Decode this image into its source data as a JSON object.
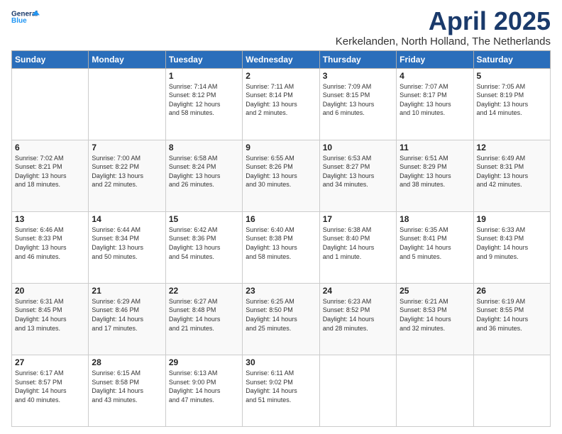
{
  "logo": {
    "line1": "General",
    "line2": "Blue"
  },
  "title": "April 2025",
  "location": "Kerkelanden, North Holland, The Netherlands",
  "weekdays": [
    "Sunday",
    "Monday",
    "Tuesday",
    "Wednesday",
    "Thursday",
    "Friday",
    "Saturday"
  ],
  "weeks": [
    [
      {
        "day": "",
        "info": ""
      },
      {
        "day": "",
        "info": ""
      },
      {
        "day": "1",
        "info": "Sunrise: 7:14 AM\nSunset: 8:12 PM\nDaylight: 12 hours\nand 58 minutes."
      },
      {
        "day": "2",
        "info": "Sunrise: 7:11 AM\nSunset: 8:14 PM\nDaylight: 13 hours\nand 2 minutes."
      },
      {
        "day": "3",
        "info": "Sunrise: 7:09 AM\nSunset: 8:15 PM\nDaylight: 13 hours\nand 6 minutes."
      },
      {
        "day": "4",
        "info": "Sunrise: 7:07 AM\nSunset: 8:17 PM\nDaylight: 13 hours\nand 10 minutes."
      },
      {
        "day": "5",
        "info": "Sunrise: 7:05 AM\nSunset: 8:19 PM\nDaylight: 13 hours\nand 14 minutes."
      }
    ],
    [
      {
        "day": "6",
        "info": "Sunrise: 7:02 AM\nSunset: 8:21 PM\nDaylight: 13 hours\nand 18 minutes."
      },
      {
        "day": "7",
        "info": "Sunrise: 7:00 AM\nSunset: 8:22 PM\nDaylight: 13 hours\nand 22 minutes."
      },
      {
        "day": "8",
        "info": "Sunrise: 6:58 AM\nSunset: 8:24 PM\nDaylight: 13 hours\nand 26 minutes."
      },
      {
        "day": "9",
        "info": "Sunrise: 6:55 AM\nSunset: 8:26 PM\nDaylight: 13 hours\nand 30 minutes."
      },
      {
        "day": "10",
        "info": "Sunrise: 6:53 AM\nSunset: 8:27 PM\nDaylight: 13 hours\nand 34 minutes."
      },
      {
        "day": "11",
        "info": "Sunrise: 6:51 AM\nSunset: 8:29 PM\nDaylight: 13 hours\nand 38 minutes."
      },
      {
        "day": "12",
        "info": "Sunrise: 6:49 AM\nSunset: 8:31 PM\nDaylight: 13 hours\nand 42 minutes."
      }
    ],
    [
      {
        "day": "13",
        "info": "Sunrise: 6:46 AM\nSunset: 8:33 PM\nDaylight: 13 hours\nand 46 minutes."
      },
      {
        "day": "14",
        "info": "Sunrise: 6:44 AM\nSunset: 8:34 PM\nDaylight: 13 hours\nand 50 minutes."
      },
      {
        "day": "15",
        "info": "Sunrise: 6:42 AM\nSunset: 8:36 PM\nDaylight: 13 hours\nand 54 minutes."
      },
      {
        "day": "16",
        "info": "Sunrise: 6:40 AM\nSunset: 8:38 PM\nDaylight: 13 hours\nand 58 minutes."
      },
      {
        "day": "17",
        "info": "Sunrise: 6:38 AM\nSunset: 8:40 PM\nDaylight: 14 hours\nand 1 minute."
      },
      {
        "day": "18",
        "info": "Sunrise: 6:35 AM\nSunset: 8:41 PM\nDaylight: 14 hours\nand 5 minutes."
      },
      {
        "day": "19",
        "info": "Sunrise: 6:33 AM\nSunset: 8:43 PM\nDaylight: 14 hours\nand 9 minutes."
      }
    ],
    [
      {
        "day": "20",
        "info": "Sunrise: 6:31 AM\nSunset: 8:45 PM\nDaylight: 14 hours\nand 13 minutes."
      },
      {
        "day": "21",
        "info": "Sunrise: 6:29 AM\nSunset: 8:46 PM\nDaylight: 14 hours\nand 17 minutes."
      },
      {
        "day": "22",
        "info": "Sunrise: 6:27 AM\nSunset: 8:48 PM\nDaylight: 14 hours\nand 21 minutes."
      },
      {
        "day": "23",
        "info": "Sunrise: 6:25 AM\nSunset: 8:50 PM\nDaylight: 14 hours\nand 25 minutes."
      },
      {
        "day": "24",
        "info": "Sunrise: 6:23 AM\nSunset: 8:52 PM\nDaylight: 14 hours\nand 28 minutes."
      },
      {
        "day": "25",
        "info": "Sunrise: 6:21 AM\nSunset: 8:53 PM\nDaylight: 14 hours\nand 32 minutes."
      },
      {
        "day": "26",
        "info": "Sunrise: 6:19 AM\nSunset: 8:55 PM\nDaylight: 14 hours\nand 36 minutes."
      }
    ],
    [
      {
        "day": "27",
        "info": "Sunrise: 6:17 AM\nSunset: 8:57 PM\nDaylight: 14 hours\nand 40 minutes."
      },
      {
        "day": "28",
        "info": "Sunrise: 6:15 AM\nSunset: 8:58 PM\nDaylight: 14 hours\nand 43 minutes."
      },
      {
        "day": "29",
        "info": "Sunrise: 6:13 AM\nSunset: 9:00 PM\nDaylight: 14 hours\nand 47 minutes."
      },
      {
        "day": "30",
        "info": "Sunrise: 6:11 AM\nSunset: 9:02 PM\nDaylight: 14 hours\nand 51 minutes."
      },
      {
        "day": "",
        "info": ""
      },
      {
        "day": "",
        "info": ""
      },
      {
        "day": "",
        "info": ""
      }
    ]
  ]
}
